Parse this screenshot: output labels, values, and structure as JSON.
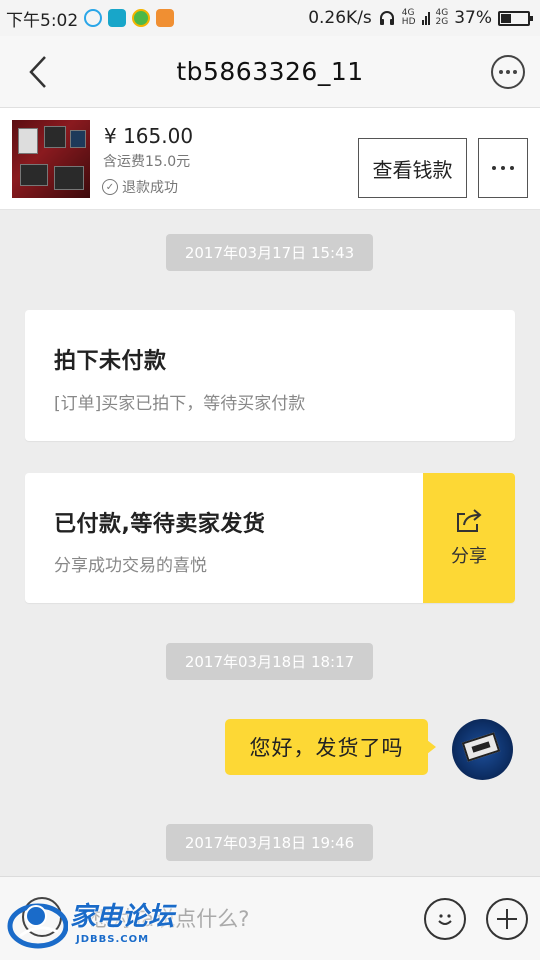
{
  "status_bar": {
    "time": "下午5:02",
    "net_speed": "0.26K/s",
    "sig1_top": "4G",
    "sig1_bot": "HD",
    "sig2_top": "4G",
    "sig2_bot": "2G",
    "battery": "37%",
    "battery_level": 0.37
  },
  "header": {
    "title": "tb5863326_11"
  },
  "product": {
    "price": "¥ 165.00",
    "shipping": "含运费15.0元",
    "status": "退款成功",
    "view_money_label": "查看钱款"
  },
  "messages": {
    "ts1": "2017年03月17日 15:43",
    "card1_title": "拍下未付款",
    "card1_desc": "[订单]买家已拍下，等待买家付款",
    "card2_title": "已付款,等待卖家发货",
    "card2_desc": "分享成功交易的喜悦",
    "share_label": "分享",
    "ts2": "2017年03月18日 18:17",
    "bubble_text": "您好，发货了吗",
    "ts3": "2017年03月18日 19:46"
  },
  "input": {
    "placeholder": "想对Ta说点什么?"
  },
  "watermark": {
    "brand": "家电论坛",
    "domain": "JDBBS.COM"
  },
  "colors": {
    "accent_yellow": "#fdd835",
    "timestamp_bg": "#cfcfcf",
    "background": "#ededed"
  }
}
